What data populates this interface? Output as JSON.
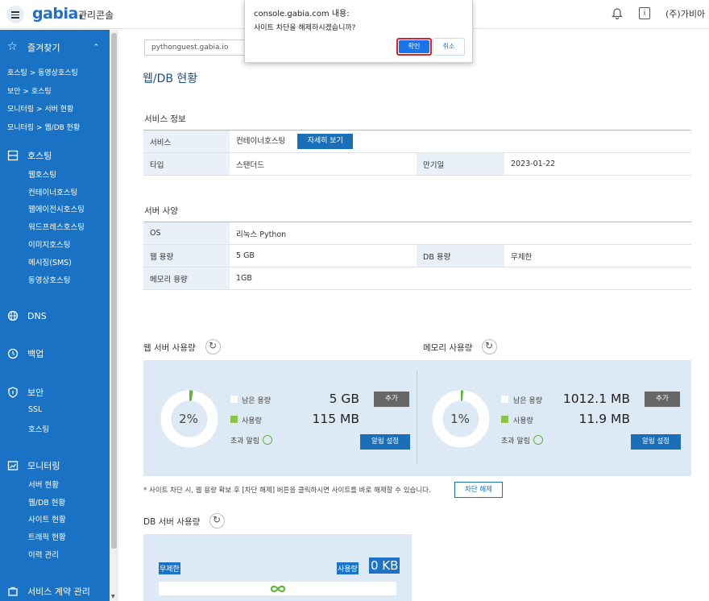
{
  "header": {
    "logo": "gabia.",
    "logo_sub": "관리콘솔",
    "company": "(주)가비아",
    "icons": [
      "menu-icon",
      "bell-icon",
      "info-icon",
      "chevron-down-icon"
    ]
  },
  "alert": {
    "title": "console.gabia.com 내용:",
    "message": "사이트 차단을 해제하시겠습니까?",
    "ok": "확인",
    "cancel": "취소"
  },
  "sidebar": {
    "favorites": "즐겨찾기",
    "fav_links": [
      "호스팅 > 동영상호스팅",
      "보안 > 호스팅",
      "모니터링 > 서버 현황",
      "모니터링 > 웹/DB 현황"
    ],
    "hosting": "호스팅",
    "hosting_items": [
      "웹호스팅",
      "컨테이너호스팅",
      "웹에이전시호스팅",
      "워드프레스호스팅",
      "이미지호스팅",
      "메시징(SMS)",
      "동영상호스팅"
    ],
    "dns": "DNS",
    "backup": "백업",
    "security": "보안",
    "security_items": [
      "SSL",
      "호스팅"
    ],
    "monitoring": "모니터링",
    "monitoring_items": [
      "서버 현황",
      "웹/DB 현황",
      "사이트 현황",
      "트래픽 현황",
      "이력 관리"
    ],
    "contract": "서비스 계약 관리"
  },
  "main": {
    "domain": "pythonguest.gabia.io",
    "page_title": "웹/DB 현황",
    "service_info_title": "서비스 정보",
    "service_label": "서비스",
    "service_value": "컨테이너호스팅",
    "detail_btn": "자세히 보기",
    "type_label": "타입",
    "type_value": "스탠더드",
    "expire_label": "만기일",
    "expire_value": "2023-01-22",
    "spec_title": "서버 사양",
    "os_label": "OS",
    "os_value": "리눅스 Python",
    "web_cap_label": "웹 용량",
    "web_cap_value": "5 GB",
    "db_cap_label": "DB 용량",
    "db_cap_value": "무제한",
    "mem_cap_label": "메모리 용량",
    "mem_cap_value": "1GB",
    "web_usage_title": "웹 서버 사용량",
    "mem_usage_title": "메모리 사용량",
    "web": {
      "percent": "2%",
      "percent_value": 0.02,
      "remain_label": "남은 용량",
      "remain_value": "5 GB",
      "used_label": "사용량",
      "used_value": "115 MB",
      "alarm_label": "초과 알림",
      "add_btn": "추가",
      "alarm_btn": "알림 설정"
    },
    "mem": {
      "percent": "1%",
      "percent_value": 0.01,
      "remain_label": "남은 용량",
      "remain_value": "1012.1 MB",
      "used_label": "사용량",
      "used_value": "11.9 MB",
      "alarm_label": "초과 알림",
      "add_btn": "추가",
      "alarm_btn": "알림 설정"
    },
    "notice": "* 사이트 차단 시, 웹 용량 확보 후 [차단 해제] 버튼을 클릭하시면 사이트를 바로 해제할 수 있습니다.",
    "unblock_btn": "차단 해제",
    "db_usage_title": "DB 서버 사용량",
    "db_unlimited": "무제한",
    "db_used_label": "사용량",
    "db_used_value": "0 KB"
  },
  "colors": {
    "sidebar": "#1a72c4",
    "accent": "#1a6fb8",
    "green": "#5fb43a",
    "panel": "#dde9f5"
  }
}
